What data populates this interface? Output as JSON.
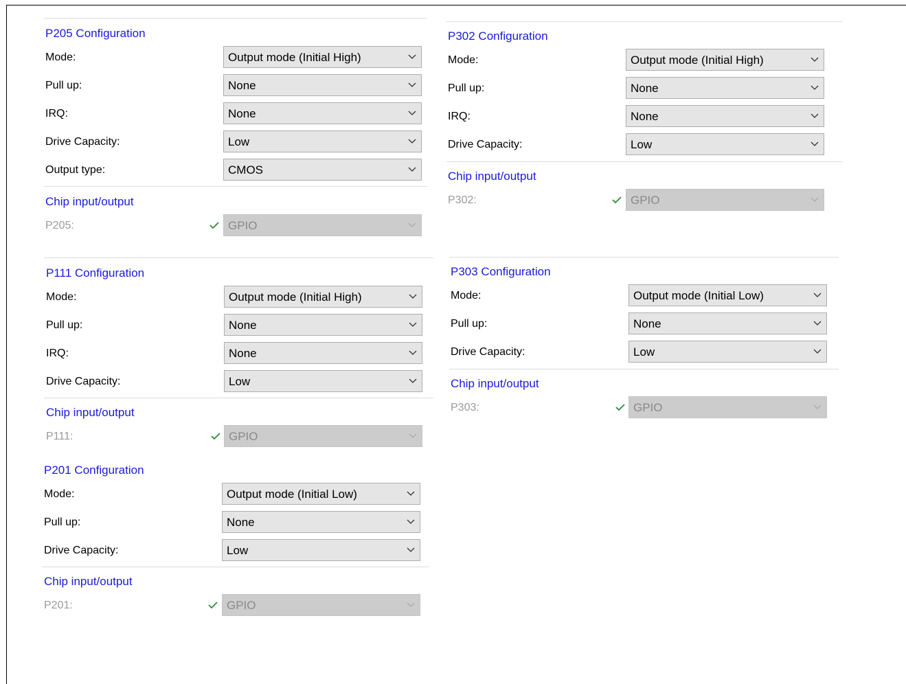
{
  "panels": {
    "p205": {
      "heading": "P205 Configuration",
      "fields": [
        {
          "label": "Mode:",
          "value": "Output mode (Initial High)"
        },
        {
          "label": "Pull up:",
          "value": "None"
        },
        {
          "label": "IRQ:",
          "value": "None"
        },
        {
          "label": "Drive Capacity:",
          "value": "Low"
        },
        {
          "label": "Output type:",
          "value": "CMOS"
        }
      ],
      "chip_heading": "Chip input/output",
      "pin_label": "P205:",
      "pin_value": "GPIO"
    },
    "p302": {
      "heading": "P302 Configuration",
      "fields": [
        {
          "label": "Mode:",
          "value": "Output mode (Initial High)"
        },
        {
          "label": "Pull up:",
          "value": "None"
        },
        {
          "label": "IRQ:",
          "value": "None"
        },
        {
          "label": "Drive Capacity:",
          "value": "Low"
        }
      ],
      "chip_heading": "Chip input/output",
      "pin_label": "P302:",
      "pin_value": "GPIO"
    },
    "p111": {
      "heading": "P111 Configuration",
      "fields": [
        {
          "label": "Mode:",
          "value": "Output mode (Initial High)"
        },
        {
          "label": "Pull up:",
          "value": "None"
        },
        {
          "label": "IRQ:",
          "value": "None"
        },
        {
          "label": "Drive Capacity:",
          "value": "Low"
        }
      ],
      "chip_heading": "Chip input/output",
      "pin_label": "P111:",
      "pin_value": "GPIO"
    },
    "p303": {
      "heading": "P303 Configuration",
      "fields": [
        {
          "label": "Mode:",
          "value": "Output mode (Initial Low)"
        },
        {
          "label": "Pull up:",
          "value": "None"
        },
        {
          "label": "Drive Capacity:",
          "value": "Low"
        }
      ],
      "chip_heading": "Chip input/output",
      "pin_label": "P303:",
      "pin_value": "GPIO"
    },
    "p201": {
      "heading": "P201 Configuration",
      "fields": [
        {
          "label": "Mode:",
          "value": "Output mode (Initial Low)"
        },
        {
          "label": "Pull up:",
          "value": "None"
        },
        {
          "label": "Drive Capacity:",
          "value": "Low"
        }
      ],
      "chip_heading": "Chip input/output",
      "pin_label": "P201:",
      "pin_value": "GPIO"
    }
  },
  "colors": {
    "heading": "#1a1adb",
    "check": "#2e8b3a",
    "select_bg": "#e5e5e5",
    "select_disabled_bg": "#cccccc"
  }
}
